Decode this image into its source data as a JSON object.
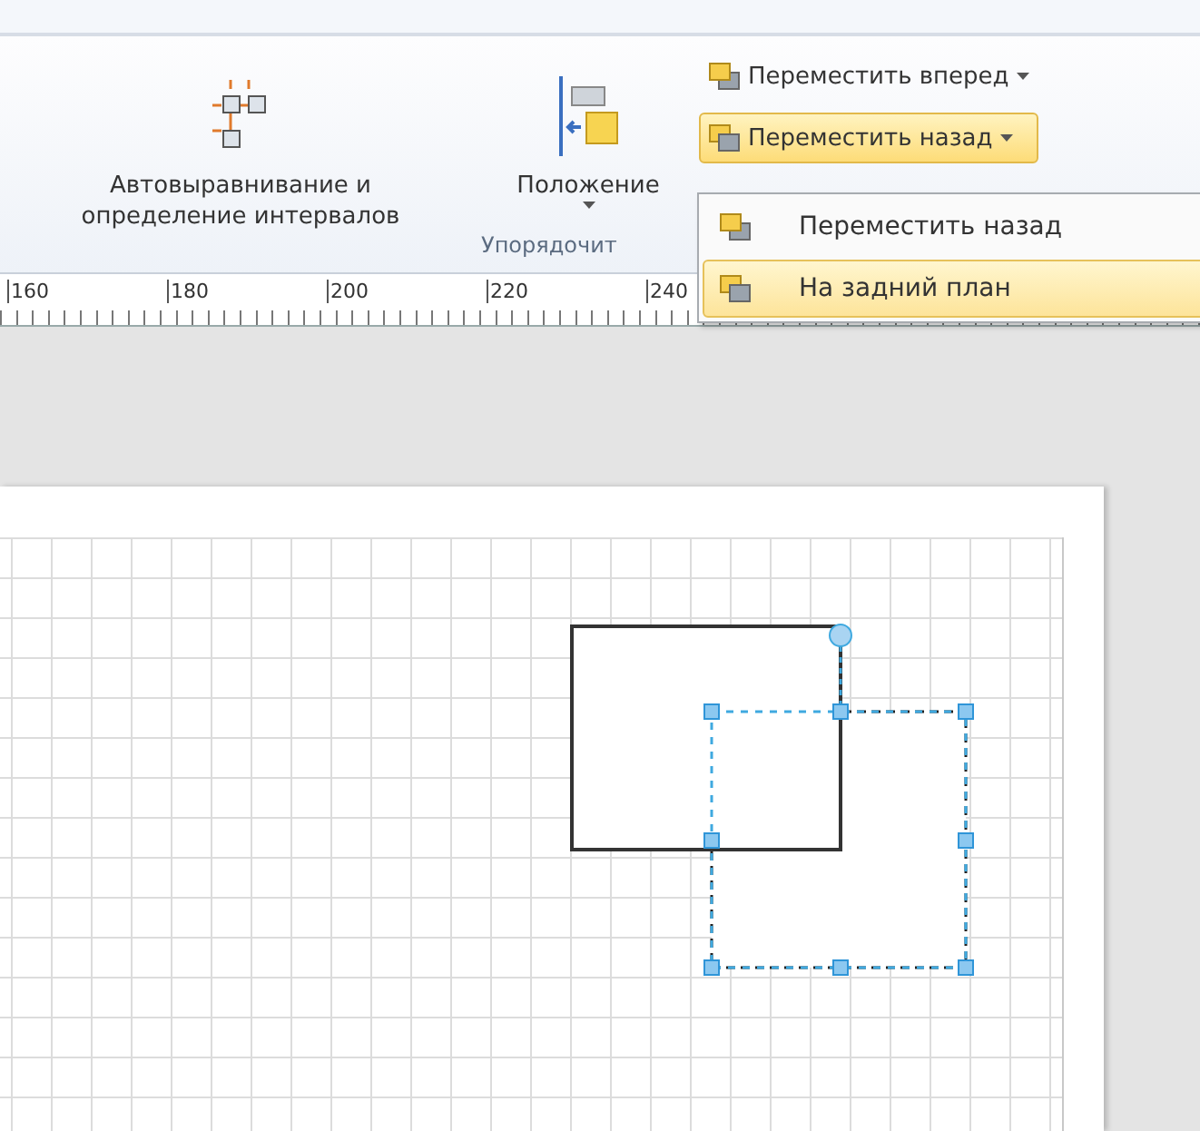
{
  "ribbon": {
    "large_buttons": [
      {
        "kind": "align",
        "lines": [
          "Автовыравнивание и",
          "определение интервалов"
        ],
        "dropdown": false
      },
      {
        "kind": "position",
        "lines": [
          "Положение"
        ],
        "dropdown": true
      }
    ],
    "small_buttons": [
      {
        "kind": "forward",
        "label": "Переместить вперед",
        "selected": false
      },
      {
        "kind": "backward",
        "label": "Переместить назад",
        "selected": true
      }
    ],
    "group_label": "Упорядочит"
  },
  "ruler": {
    "labels": [
      "160",
      "180",
      "200",
      "220",
      "240"
    ]
  },
  "menu": {
    "items": [
      {
        "kind": "backward",
        "label": "Переместить назад",
        "selected": false
      },
      {
        "kind": "to_back",
        "label": "На задний план",
        "selected": true
      }
    ]
  }
}
